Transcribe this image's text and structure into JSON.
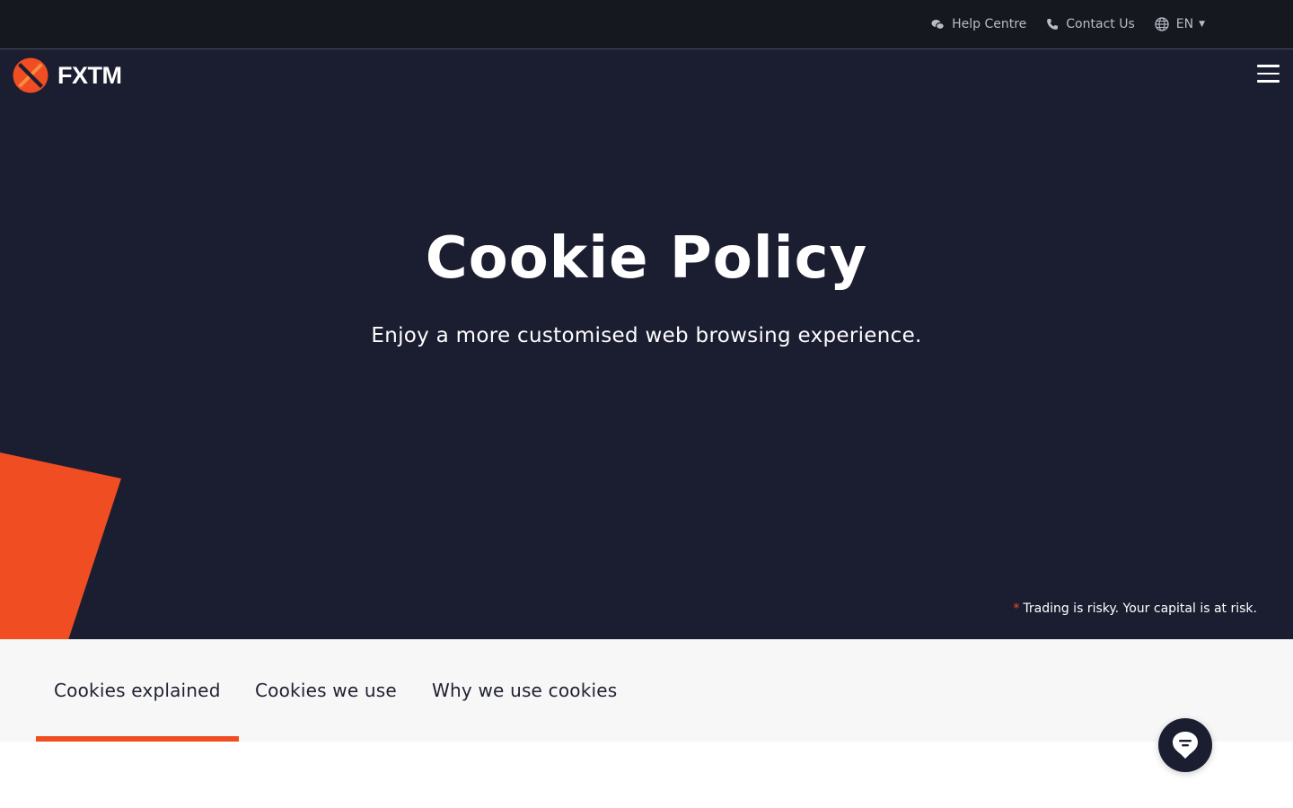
{
  "topbar": {
    "help_label": "Help Centre",
    "contact_label": "Contact Us",
    "language": "EN"
  },
  "header": {
    "logo_text": "FXTM"
  },
  "hero": {
    "title": "Cookie Policy",
    "subtitle": "Enjoy a more customised web browsing experience.",
    "risk_star": "*",
    "risk_text": "Trading is risky. Your capital is at risk."
  },
  "tabs": [
    {
      "label": "Cookies explained",
      "active": true
    },
    {
      "label": "Cookies we use",
      "active": false
    },
    {
      "label": "Why we use cookies",
      "active": false
    }
  ],
  "colors": {
    "accent": "#f04d23",
    "hero_bg": "#1b1d31",
    "topbar_bg": "#16181f"
  },
  "icons": {
    "help": "chat-bubbles-icon",
    "contact": "phone-icon",
    "language": "globe-icon",
    "menu": "hamburger-icon",
    "chat": "chat-support-icon"
  }
}
